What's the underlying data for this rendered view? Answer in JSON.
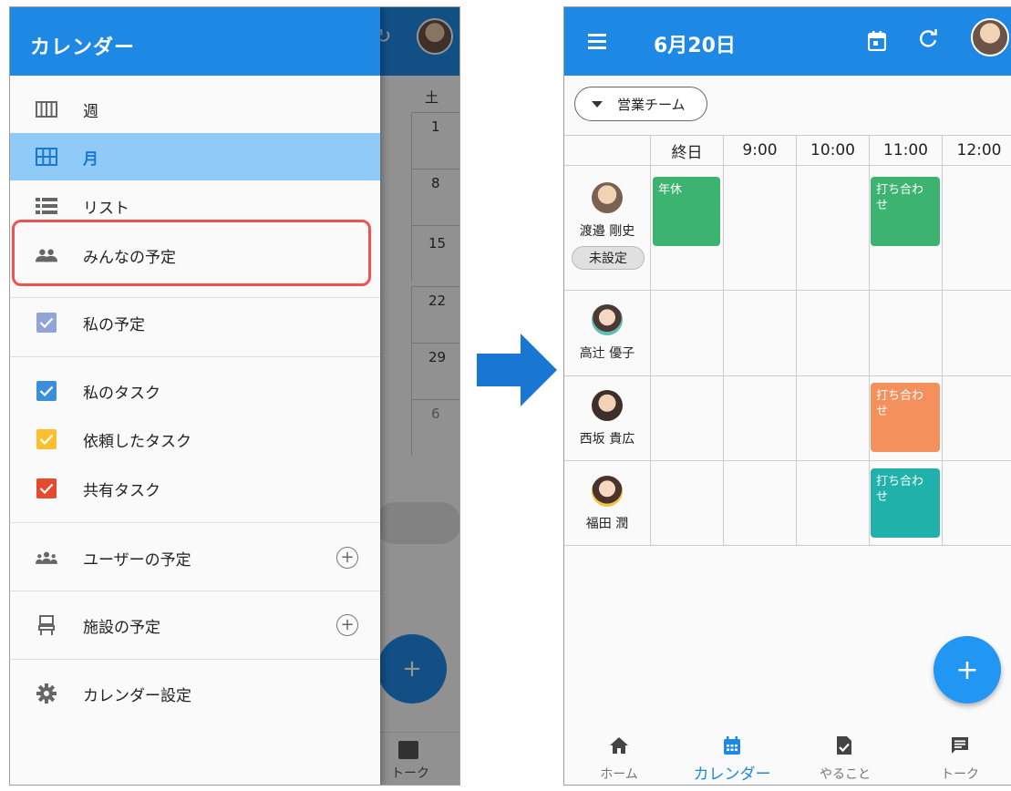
{
  "left": {
    "drawer_title": "カレンダー",
    "views": [
      {
        "label": "週",
        "icon": "week-view-icon"
      },
      {
        "label": "月",
        "icon": "month-view-icon",
        "active": true
      },
      {
        "label": "リスト",
        "icon": "list-view-icon"
      },
      {
        "label": "みんなの予定",
        "icon": "people-icon",
        "highlighted": true
      }
    ],
    "my_schedule": {
      "label": "私の予定",
      "checked": true,
      "color": "#90a4d8"
    },
    "tasks": [
      {
        "label": "私のタスク",
        "color": "#3b8fd8"
      },
      {
        "label": "依頼したタスク",
        "color": "#fbc02d"
      },
      {
        "label": "共有タスク",
        "color": "#e64a2e"
      }
    ],
    "user_schedule": {
      "label": "ユーザーの予定",
      "icon": "group-icon"
    },
    "facility_schedule": {
      "label": "施設の予定",
      "icon": "facility-icon"
    },
    "settings": {
      "label": "カレンダー設定",
      "icon": "gear-icon"
    },
    "background": {
      "weekday_header": "土",
      "dates": [
        "1",
        "8",
        "15",
        "22",
        "29",
        "6"
      ],
      "fab_symbol": "+",
      "talk_label": "トーク"
    },
    "highlight_color": "#ef5350"
  },
  "right": {
    "title": "6月20日",
    "team_chip": "営業チーム",
    "columns": [
      "終日",
      "9:00",
      "10:00",
      "11:00",
      "12:00"
    ],
    "people": [
      {
        "name": "渡邉 剛史",
        "status": "未設定"
      },
      {
        "name": "高辻 優子"
      },
      {
        "name": "西坂 貴広"
      },
      {
        "name": "福田 潤"
      }
    ],
    "events": [
      {
        "label": "年休",
        "color": "#3cb371"
      },
      {
        "label": "打ち合わせ",
        "color": "#3cb371"
      },
      {
        "label": "打ち合わせ",
        "color": "#f4905c"
      },
      {
        "label": "打ち合わせ",
        "color": "#20b2aa"
      }
    ],
    "fab_symbol": "+",
    "nav": [
      {
        "label": "ホーム",
        "icon": "home-icon"
      },
      {
        "label": "カレンダー",
        "icon": "calendar-icon",
        "active": true
      },
      {
        "label": "やること",
        "icon": "todo-icon"
      },
      {
        "label": "トーク",
        "icon": "chat-icon"
      }
    ],
    "accent": "#1e88e5"
  }
}
